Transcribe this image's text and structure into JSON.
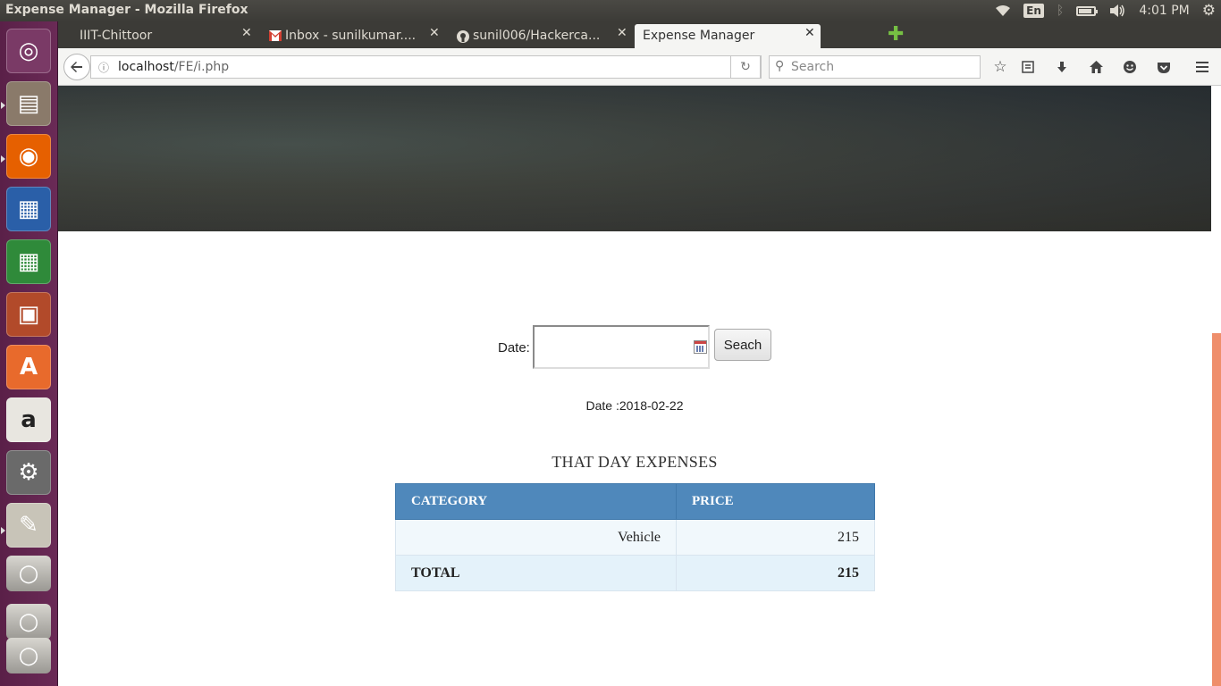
{
  "window": {
    "title": "Expense Manager - Mozilla Firefox",
    "keyboard_layout": "En",
    "time": "4:01 PM",
    "battery_level": 0.75
  },
  "launcher": {
    "items": [
      {
        "name": "ubuntu-dash-icon",
        "color": "#7a3a66"
      },
      {
        "name": "files-icon",
        "color": "#8a7a6a"
      },
      {
        "name": "firefox-icon",
        "color": "#e66000"
      },
      {
        "name": "writer-icon",
        "color": "#2a5fa8"
      },
      {
        "name": "calc-icon",
        "color": "#2f8a3a"
      },
      {
        "name": "impress-icon",
        "color": "#b24a2a"
      },
      {
        "name": "software-center-icon",
        "color": "#e86a2c"
      },
      {
        "name": "amazon-icon",
        "color": "#e8e6e0"
      },
      {
        "name": "system-settings-icon",
        "color": "#6a6a6a"
      },
      {
        "name": "text-editor-icon",
        "color": "#c8c4b8"
      },
      {
        "name": "drive-icon",
        "color": "#b8b6b0"
      },
      {
        "name": "drive-icon",
        "color": "#b8b6b0"
      },
      {
        "name": "trash-icon",
        "color": "#b8b6b0"
      }
    ]
  },
  "tabs": [
    {
      "label": "IIIT-Chittoor",
      "active": false
    },
    {
      "label": "Inbox - sunilkumar....",
      "active": false
    },
    {
      "label": "sunil006/Hackerca...",
      "active": false
    },
    {
      "label": "Expense Manager",
      "active": true
    }
  ],
  "navbar": {
    "url_host": "localhost",
    "url_path": "/FE/i.php",
    "search_placeholder": "Search"
  },
  "form": {
    "date_label": "Date:",
    "date_value": "",
    "search_button": "Seach"
  },
  "result": {
    "date_line": "Date :2018-02-22",
    "caption": "THAT DAY EXPENSES",
    "headers": [
      "CATEGORY",
      "PRICE"
    ],
    "rows": [
      {
        "category": "Vehicle",
        "price": "215"
      }
    ],
    "total_label": "TOTAL",
    "total_value": "215"
  },
  "colors": {
    "table_header": "#4f88bb",
    "scroll_thumb": "#ef8e6b",
    "launcher_bg": "#5a2048"
  }
}
